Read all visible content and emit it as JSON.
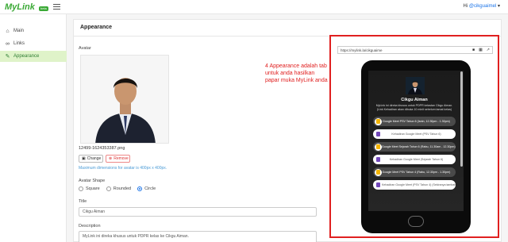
{
  "header": {
    "app_name": "MyLink",
    "badge": "beta",
    "greeting_prefix": "Hi ",
    "username": "@cikguaimel"
  },
  "sidebar": {
    "items": [
      {
        "label": "Main",
        "icon": "home-icon",
        "glyph": "⌂"
      },
      {
        "label": "Links",
        "icon": "link-icon",
        "glyph": "🔗"
      },
      {
        "label": "Appearance",
        "icon": "paint-brush-icon",
        "glyph": "✎"
      }
    ],
    "active_index": 2
  },
  "appearance": {
    "title": "Appearance",
    "avatar_label": "Avatar",
    "avatar_filename": "12499-1624353387.png",
    "change_label": "Change",
    "remove_label": "Remove",
    "hint": "Maximum dimensions for avatar is 400px x 400px.",
    "avatar_shape_label": "Avatar Shape",
    "shapes": [
      "Square",
      "Rounded",
      "Circle"
    ],
    "selected_shape": "Circle",
    "title_label": "Title",
    "title_value": "Cikgu Aiman",
    "description_label": "Description",
    "description_value": "MyLink ini direka khusus untuk PDPR kelas ke Cikgu Aiman."
  },
  "annotation": "4 Appearance adalah tab untuk anda hasilkan papar muka MyLink anda",
  "preview": {
    "url": "https://mylink.la/cikguaime",
    "profile_name": "Cikgu Aiman",
    "profile_desc": "MyLink ini direka khusus untuk PDPR kelastan Cikgu Aiman. (Link Kehadiran akan dibuka 10 minit sebelum tamat kelas)",
    "links": [
      {
        "text": "Google Meet PSV Tahun 6 (Isnin, 12.30pm - 1.30pm)",
        "style": "dark",
        "icon": "google-meet-icon",
        "color": "#f4b400"
      },
      {
        "text": "Kehadiran Google Meet (PSV Tahun 6)",
        "style": "light",
        "icon": "google-forms-icon",
        "color": "#7248b9"
      },
      {
        "text": "Google Meet Sejarah Tahun 6 (Rabu, 11.30am - 12.30pm)",
        "style": "dark",
        "icon": "google-meet-icon",
        "color": "#f4b400"
      },
      {
        "text": "Kehadiran Google Meet (Sejarah Tahun 6)",
        "style": "light",
        "icon": "google-forms-icon",
        "color": "#7248b9"
      },
      {
        "text": "Google Meet PSV Tahun 4 (Rabu, 12.30pm - 1.30pm)",
        "style": "dark",
        "icon": "google-meet-icon",
        "color": "#f4b400"
      },
      {
        "text": "Kehadiran Google Meet (PSV Tahun 4) (Sekiranya tambahan)",
        "style": "light",
        "icon": "google-forms-icon",
        "color": "#7248b9"
      }
    ]
  },
  "colors": {
    "brand": "#3aa935",
    "annotation": "#e02020",
    "link_blue": "#1a73e8"
  }
}
